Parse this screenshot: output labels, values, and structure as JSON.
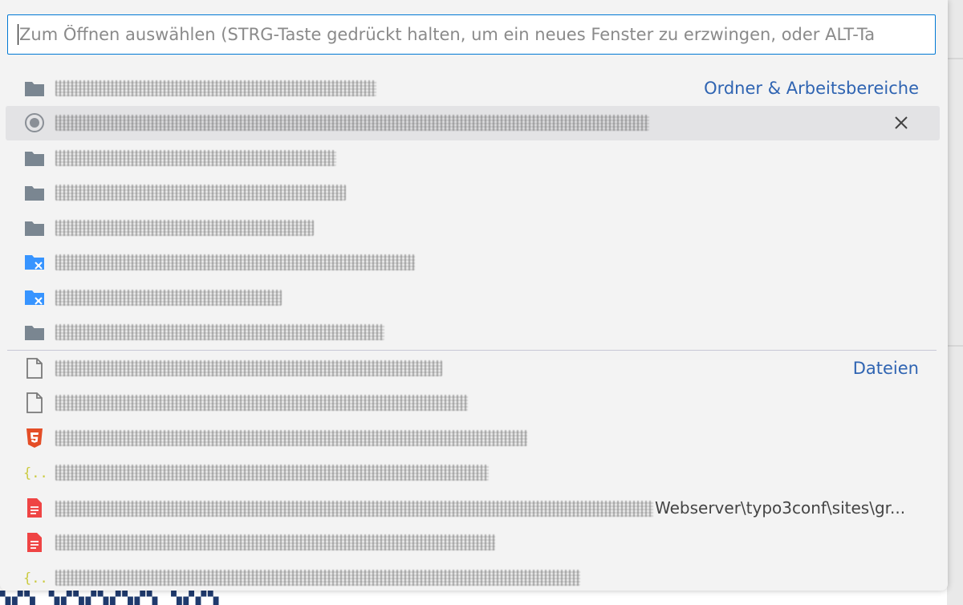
{
  "quick_open": {
    "placeholder": "Zum Öffnen auswählen (STRG-Taste gedrückt halten, um ein neues Fenster zu erzwingen, oder ALT-Ta",
    "input_value": ""
  },
  "groups": {
    "folders_label": "Ordner & Arbeitsbereiche",
    "files_label": "Dateien"
  },
  "folder_items": [
    {
      "icon": "folder-icon"
    },
    {
      "icon": "recent-workspace-icon",
      "selected": true
    },
    {
      "icon": "folder-icon"
    },
    {
      "icon": "folder-icon"
    },
    {
      "icon": "folder-icon"
    },
    {
      "icon": "remote-folder-icon"
    },
    {
      "icon": "remote-folder-icon"
    },
    {
      "icon": "folder-icon"
    }
  ],
  "file_items": [
    {
      "icon": "file-icon"
    },
    {
      "icon": "file-icon"
    },
    {
      "icon": "html5-icon"
    },
    {
      "icon": "json-icon"
    },
    {
      "icon": "pdf-icon",
      "path_visible": "Webserver\\typo3conf\\sites\\gr..."
    },
    {
      "icon": "pdf-icon"
    },
    {
      "icon": "json-icon"
    }
  ],
  "colors": {
    "accent_border": "#0078d4",
    "group_label": "#2f64b2",
    "folder_gray": "#7a8691",
    "remote_folder_blue": "#3794ff",
    "html5_orange": "#e44d26",
    "json_yellow": "#cbcb41",
    "pdf_red": "#ef4444"
  }
}
